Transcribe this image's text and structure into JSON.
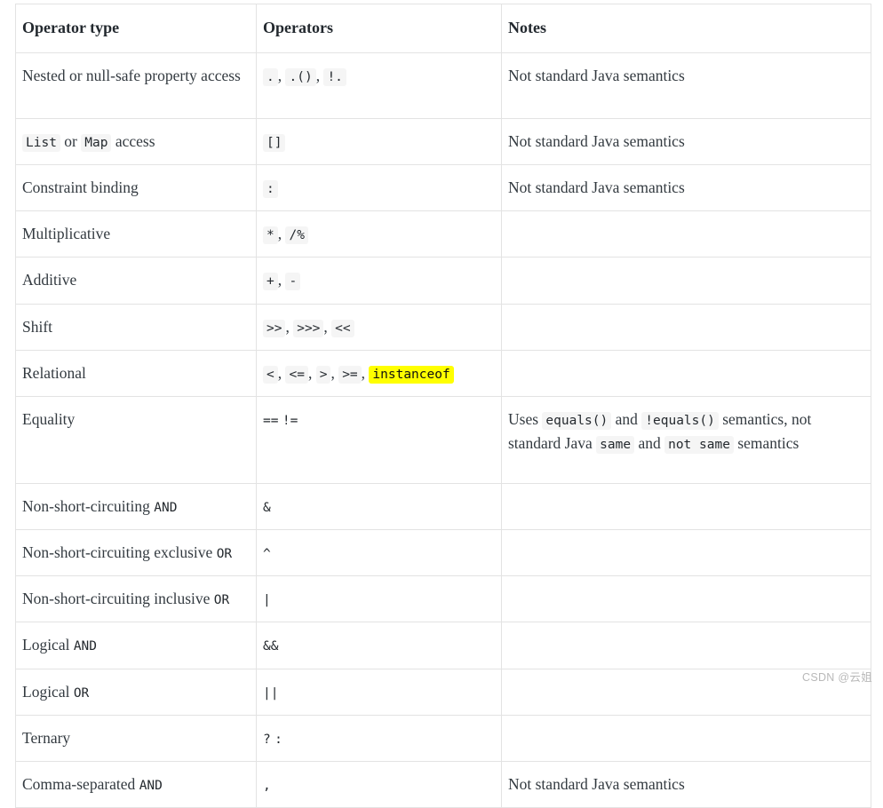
{
  "table": {
    "headers": [
      "Operator type",
      "Operators",
      "Notes"
    ],
    "rows": [
      {
        "type_parts": [
          {
            "t": "Nested or null-safe property access",
            "k": "text"
          }
        ],
        "operator_parts": [
          {
            "t": ".",
            "k": "code"
          },
          {
            "t": ", ",
            "k": "sep"
          },
          {
            "t": ".()",
            "k": "code"
          },
          {
            "t": ", ",
            "k": "sep"
          },
          {
            "t": "!.",
            "k": "code"
          }
        ],
        "notes_parts": [
          {
            "t": "Not standard Java semantics",
            "k": "text"
          }
        ]
      },
      {
        "type_parts": [
          {
            "t": "List",
            "k": "code"
          },
          {
            "t": " or ",
            "k": "sep"
          },
          {
            "t": "Map",
            "k": "code"
          },
          {
            "t": " access",
            "k": "sep"
          }
        ],
        "operator_parts": [
          {
            "t": "[]",
            "k": "code"
          }
        ],
        "notes_parts": [
          {
            "t": "Not standard Java semantics",
            "k": "text"
          }
        ]
      },
      {
        "type_parts": [
          {
            "t": "Constraint binding",
            "k": "text"
          }
        ],
        "operator_parts": [
          {
            "t": ":",
            "k": "code"
          }
        ],
        "notes_parts": [
          {
            "t": "Not standard Java semantics",
            "k": "text"
          }
        ]
      },
      {
        "type_parts": [
          {
            "t": "Multiplicative",
            "k": "text"
          }
        ],
        "operator_parts": [
          {
            "t": "*",
            "k": "code"
          },
          {
            "t": ", ",
            "k": "sep"
          },
          {
            "t": "/%",
            "k": "code"
          }
        ],
        "notes_parts": []
      },
      {
        "type_parts": [
          {
            "t": "Additive",
            "k": "text"
          }
        ],
        "operator_parts": [
          {
            "t": "+",
            "k": "code"
          },
          {
            "t": ", ",
            "k": "sep"
          },
          {
            "t": "-",
            "k": "code"
          }
        ],
        "notes_parts": []
      },
      {
        "type_parts": [
          {
            "t": "Shift",
            "k": "text"
          }
        ],
        "operator_parts": [
          {
            "t": ">>",
            "k": "code"
          },
          {
            "t": ", ",
            "k": "sep"
          },
          {
            "t": ">>>",
            "k": "code"
          },
          {
            "t": ", ",
            "k": "sep"
          },
          {
            "t": "<<",
            "k": "code"
          }
        ],
        "notes_parts": []
      },
      {
        "type_parts": [
          {
            "t": "Relational",
            "k": "text"
          }
        ],
        "operator_parts": [
          {
            "t": "<",
            "k": "code"
          },
          {
            "t": ", ",
            "k": "sep"
          },
          {
            "t": "<=",
            "k": "code"
          },
          {
            "t": ", ",
            "k": "sep"
          },
          {
            "t": ">",
            "k": "code"
          },
          {
            "t": ", ",
            "k": "sep"
          },
          {
            "t": ">=",
            "k": "code"
          },
          {
            "t": ", ",
            "k": "sep"
          },
          {
            "t": "instanceof",
            "k": "code-highlight"
          }
        ],
        "notes_parts": []
      },
      {
        "type_parts": [
          {
            "t": "Equality",
            "k": "text"
          }
        ],
        "operator_parts": [
          {
            "t": "==",
            "k": "code-plain"
          },
          {
            "t": " ",
            "k": "sep"
          },
          {
            "t": "!=",
            "k": "code-plain"
          }
        ],
        "notes_parts": [
          {
            "t": "Uses ",
            "k": "text"
          },
          {
            "t": "equals()",
            "k": "code"
          },
          {
            "t": " and ",
            "k": "text"
          },
          {
            "t": "!equals()",
            "k": "code"
          },
          {
            "t": " semantics, not standard Java ",
            "k": "text"
          },
          {
            "t": "same",
            "k": "code"
          },
          {
            "t": " and ",
            "k": "text"
          },
          {
            "t": "not same",
            "k": "code"
          },
          {
            "t": " semantics",
            "k": "text"
          }
        ]
      },
      {
        "type_parts": [
          {
            "t": "Non-short-circuiting ",
            "k": "text"
          },
          {
            "t": "AND",
            "k": "code-plain"
          }
        ],
        "operator_parts": [
          {
            "t": "&",
            "k": "code-plain"
          }
        ],
        "notes_parts": []
      },
      {
        "type_parts": [
          {
            "t": "Non-short-circuiting exclusive ",
            "k": "text"
          },
          {
            "t": "OR",
            "k": "code-plain"
          }
        ],
        "operator_parts": [
          {
            "t": "^",
            "k": "code-plain"
          }
        ],
        "notes_parts": []
      },
      {
        "type_parts": [
          {
            "t": "Non-short-circuiting inclusive ",
            "k": "text"
          },
          {
            "t": "OR",
            "k": "code-plain"
          }
        ],
        "operator_parts": [
          {
            "t": "|",
            "k": "code-plain"
          }
        ],
        "notes_parts": []
      },
      {
        "type_parts": [
          {
            "t": "Logical ",
            "k": "text"
          },
          {
            "t": "AND",
            "k": "code-plain"
          }
        ],
        "operator_parts": [
          {
            "t": "&&",
            "k": "code-plain"
          }
        ],
        "notes_parts": []
      },
      {
        "type_parts": [
          {
            "t": "Logical ",
            "k": "text"
          },
          {
            "t": "OR",
            "k": "code-plain"
          }
        ],
        "operator_parts": [
          {
            "t": "||",
            "k": "code-plain"
          }
        ],
        "notes_parts": []
      },
      {
        "type_parts": [
          {
            "t": "Ternary",
            "k": "text"
          }
        ],
        "operator_parts": [
          {
            "t": "?",
            "k": "code-plain"
          },
          {
            "t": " ",
            "k": "sep"
          },
          {
            "t": ":",
            "k": "code-plain"
          }
        ],
        "notes_parts": []
      },
      {
        "type_parts": [
          {
            "t": "Comma-separated ",
            "k": "text"
          },
          {
            "t": "AND",
            "k": "code-plain"
          }
        ],
        "operator_parts": [
          {
            "t": ",",
            "k": "code-plain"
          }
        ],
        "notes_parts": [
          {
            "t": "Not standard Java semantics",
            "k": "text"
          }
        ]
      }
    ]
  },
  "watermark": {
    "text": "CSDN @云姐"
  },
  "colors": {
    "border": "#e3e3e3",
    "text": "#333a40",
    "code_bg": "#f5f5f5",
    "highlight_bg": "#ffff00",
    "watermark": "#b9b9b9"
  }
}
